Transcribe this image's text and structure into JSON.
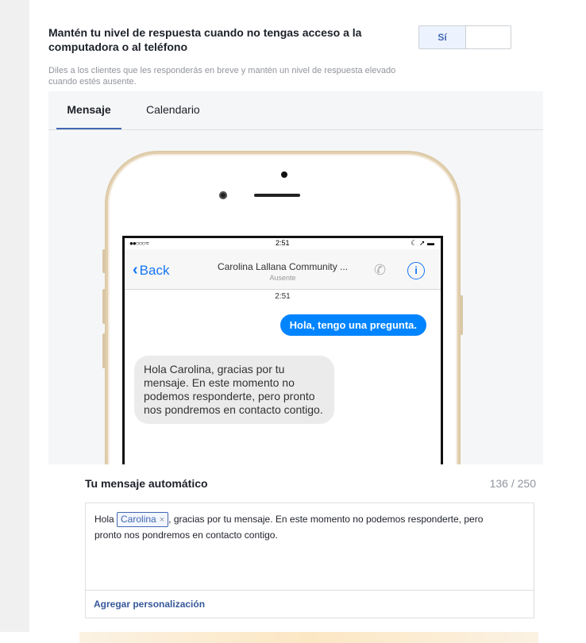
{
  "setting": {
    "title": "Mantén tu nivel de respuesta cuando no tengas acceso a la computadora o al teléfono",
    "description": "Diles a los clientes que les responderás en breve y mantén un nivel de respuesta elevado cuando estés ausente.",
    "toggle_label": "Sí",
    "toggle_state": "on"
  },
  "tabs": [
    {
      "label": "Mensaje",
      "active": true
    },
    {
      "label": "Calendario",
      "active": false
    }
  ],
  "phone": {
    "status_time": "2:51",
    "back_label": "Back",
    "chat_title": "Carolina Lallana Community ...",
    "chat_status": "Ausente",
    "message_time": "2:51",
    "outgoing_message": "Hola, tengo una pregunta.",
    "incoming_message": "Hola Carolina, gracias por tu mensaje. En este momento no podemos responderte, pero pronto nos pondremos en contacto contigo."
  },
  "auto_message": {
    "title": "Tu mensaje automático",
    "count": "136 / 250",
    "text_before": "Hola ",
    "token": "Carolina",
    "token_remove": "×",
    "text_after": ", gracias por tu mensaje. En este momento no podemos responderte, pero pronto nos pondremos en contacto contigo.",
    "add_personalization": "Agregar personalización"
  },
  "colors": {
    "accent": "#4267b2",
    "messenger_blue": "#0084ff",
    "phone_gold": "#e2cfae"
  }
}
